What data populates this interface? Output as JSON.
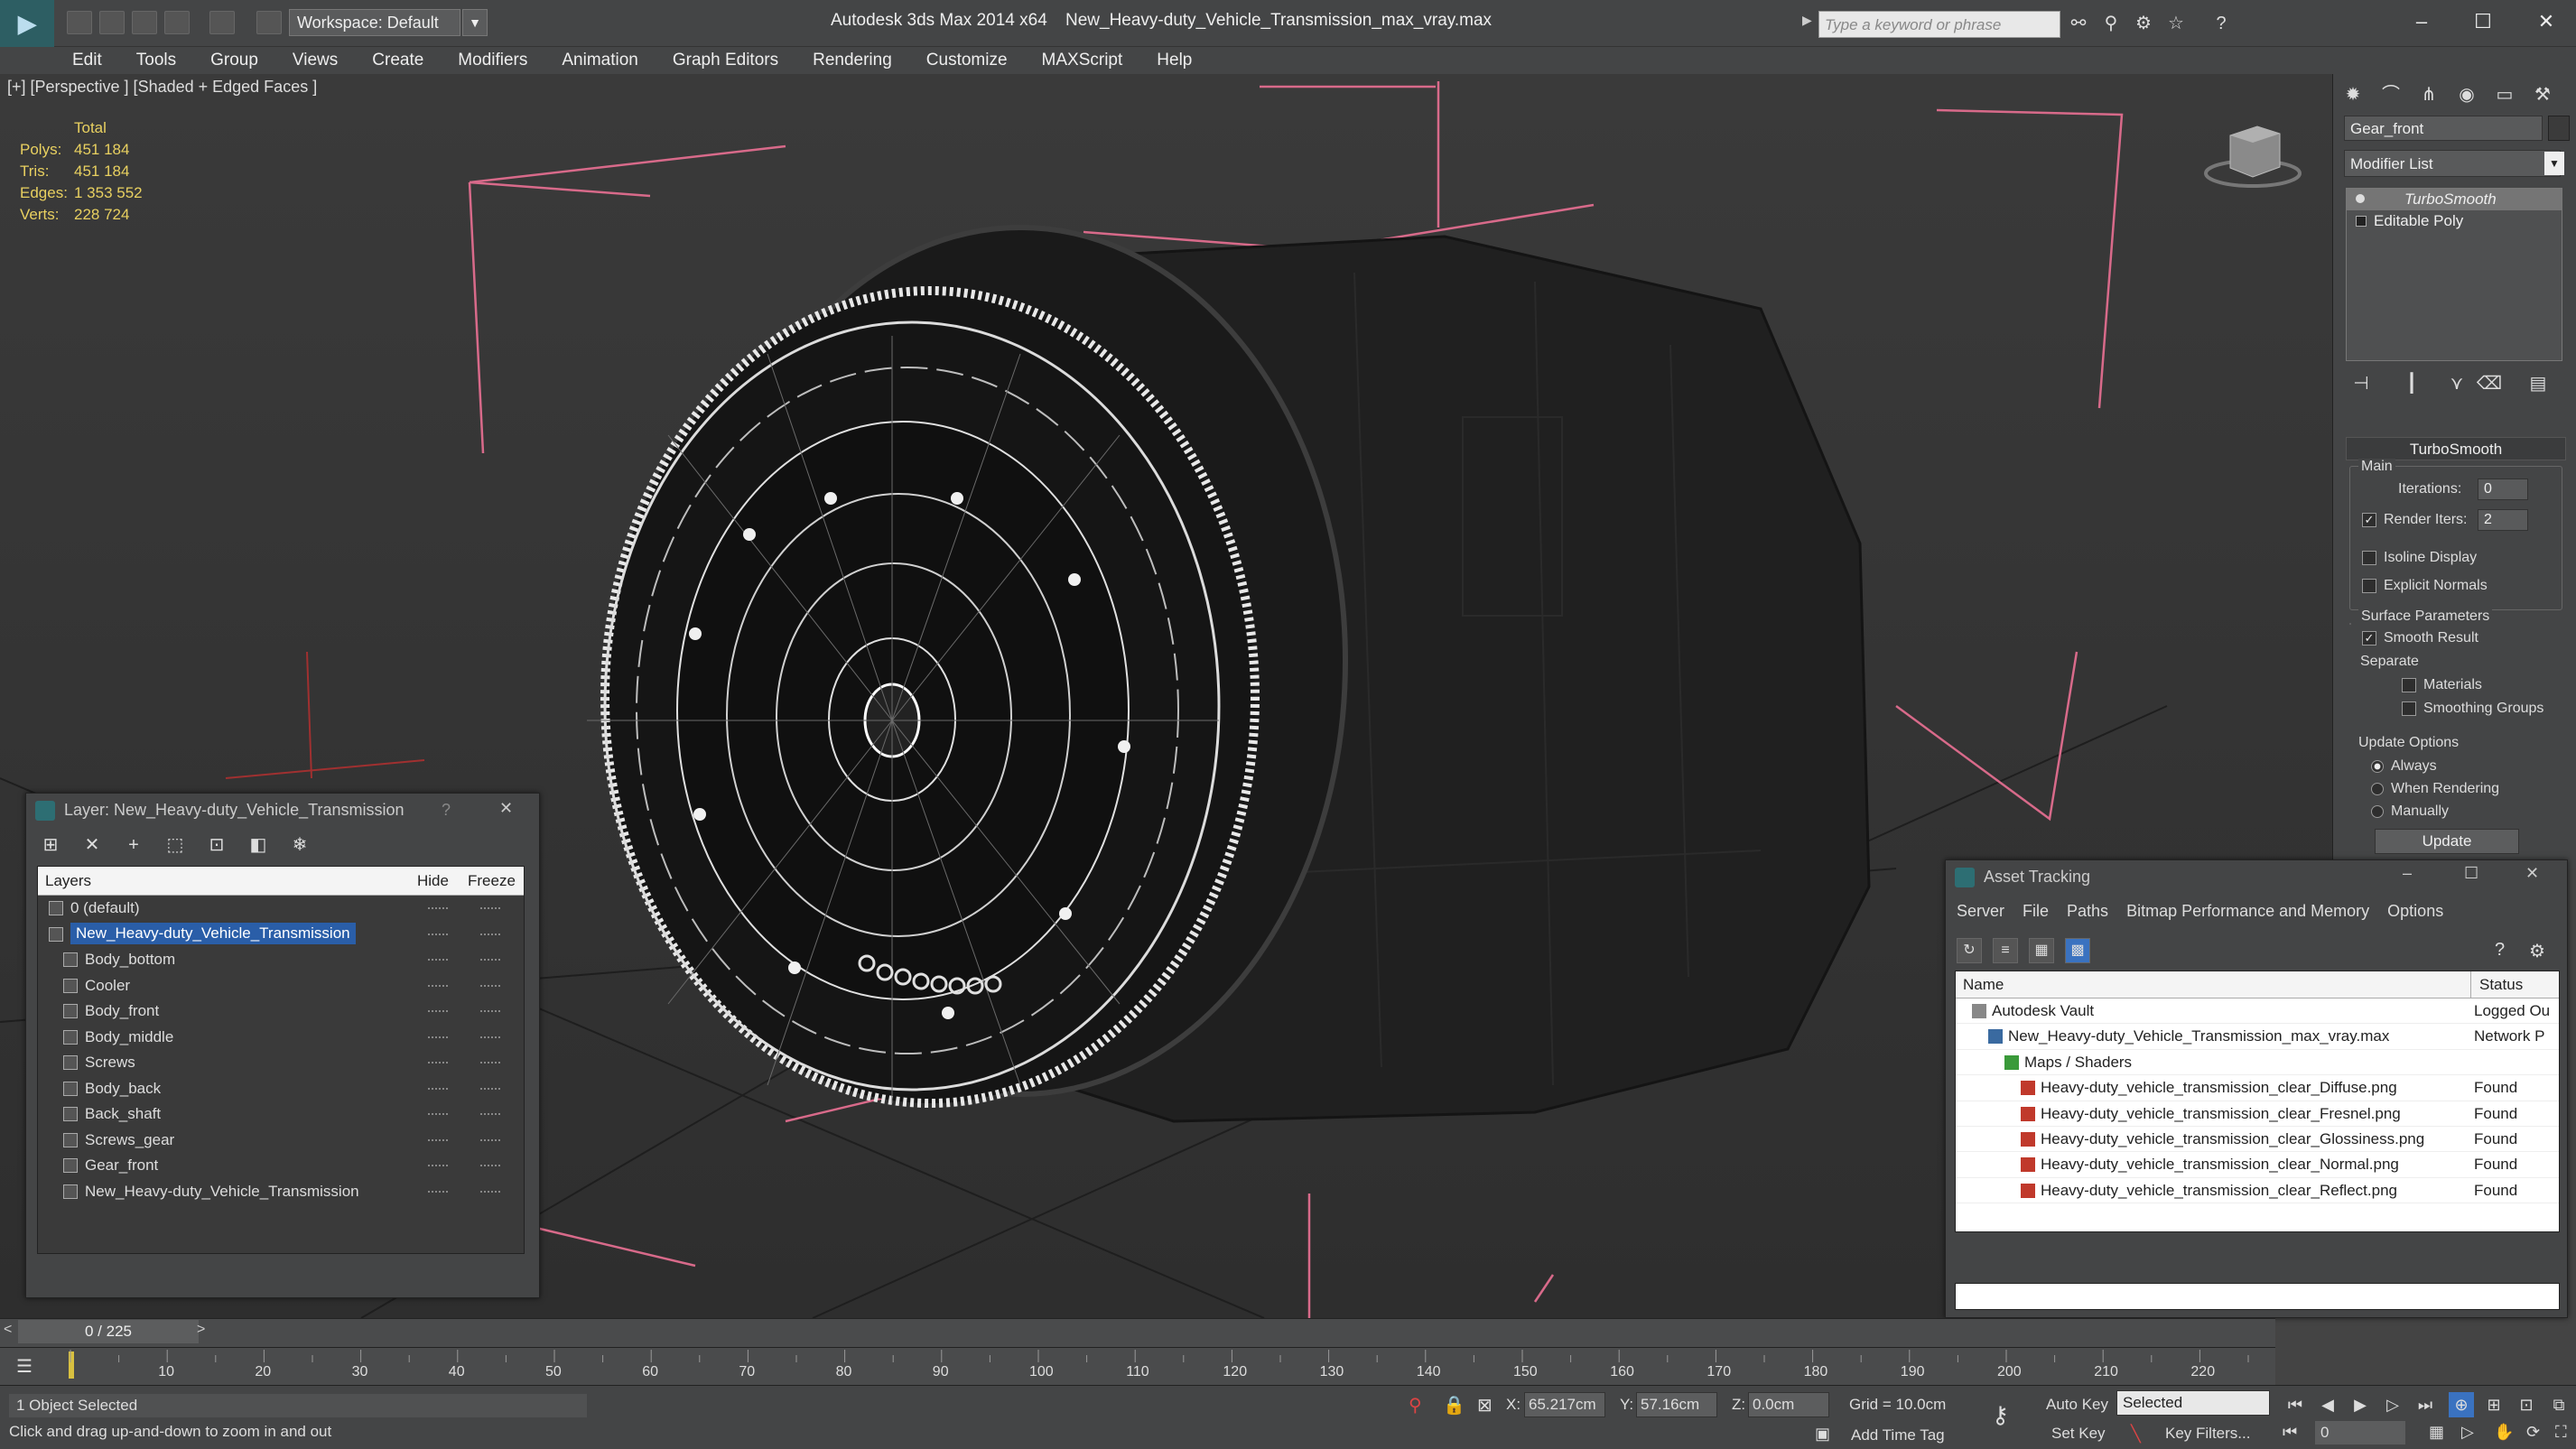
{
  "titlebar": {
    "workspace": "Workspace: Default",
    "app_title": "Autodesk 3ds Max  2014 x64",
    "doc_title": "New_Heavy-duty_Vehicle_Transmission_max_vray.max",
    "search_placeholder": "Type a keyword or phrase"
  },
  "menu": [
    "Edit",
    "Tools",
    "Group",
    "Views",
    "Create",
    "Modifiers",
    "Animation",
    "Graph Editors",
    "Rendering",
    "Customize",
    "MAXScript",
    "Help"
  ],
  "viewport": {
    "label": "[+] [Perspective ] [Shaded + Edged Faces ]",
    "stats_header": "Total",
    "stats": [
      {
        "k": "Polys:",
        "v": "451 184"
      },
      {
        "k": "Tris:",
        "v": "451 184"
      },
      {
        "k": "Edges:",
        "v": "1 353 552"
      },
      {
        "k": "Verts:",
        "v": "228 724"
      }
    ]
  },
  "command_panel": {
    "object_name": "Gear_front",
    "modifier_list": "Modifier List",
    "stack": [
      "TurboSmooth",
      "Editable Poly"
    ],
    "rollout_title": "TurboSmooth",
    "main_label": "Main",
    "iterations_label": "Iterations:",
    "iterations": "0",
    "render_iters_label": "Render Iters:",
    "render_iters": "2",
    "isoline": "Isoline Display",
    "explicit_normals": "Explicit Normals",
    "surface_params": "Surface Parameters",
    "smooth_result": "Smooth Result",
    "separate": "Separate",
    "materials": "Materials",
    "smoothing_groups": "Smoothing Groups",
    "update_options": "Update Options",
    "always": "Always",
    "when_rendering": "When Rendering",
    "manually": "Manually",
    "update_btn": "Update"
  },
  "layer_dialog": {
    "title": "Layer: New_Heavy-duty_Vehicle_Transmission",
    "help": "?",
    "close": "✕",
    "col_layers": "Layers",
    "col_hide": "Hide",
    "col_freeze": "Freeze",
    "rows": [
      {
        "name": "0 (default)",
        "indent": 0
      },
      {
        "name": "New_Heavy-duty_Vehicle_Transmission",
        "indent": 0,
        "selected": true
      },
      {
        "name": "Body_bottom",
        "indent": 1
      },
      {
        "name": "Cooler",
        "indent": 1
      },
      {
        "name": "Body_front",
        "indent": 1
      },
      {
        "name": "Body_middle",
        "indent": 1
      },
      {
        "name": "Screws",
        "indent": 1
      },
      {
        "name": "Body_back",
        "indent": 1
      },
      {
        "name": "Back_shaft",
        "indent": 1
      },
      {
        "name": "Screws_gear",
        "indent": 1
      },
      {
        "name": "Gear_front",
        "indent": 1
      },
      {
        "name": "New_Heavy-duty_Vehicle_Transmission",
        "indent": 1
      }
    ]
  },
  "asset_dialog": {
    "title": "Asset Tracking",
    "menu": [
      "Server",
      "File",
      "Paths",
      "Bitmap Performance and Memory",
      "Options"
    ],
    "col_name": "Name",
    "col_status": "Status",
    "rows": [
      {
        "name": "Autodesk Vault",
        "status": "Logged Ou",
        "level": 0
      },
      {
        "name": "New_Heavy-duty_Vehicle_Transmission_max_vray.max",
        "status": "Network P",
        "level": 1
      },
      {
        "name": "Maps / Shaders",
        "status": "",
        "level": 2
      },
      {
        "name": "Heavy-duty_vehicle_transmission_clear_Diffuse.png",
        "status": "Found",
        "level": 3
      },
      {
        "name": "Heavy-duty_vehicle_transmission_clear_Fresnel.png",
        "status": "Found",
        "level": 3
      },
      {
        "name": "Heavy-duty_vehicle_transmission_clear_Glossiness.png",
        "status": "Found",
        "level": 3
      },
      {
        "name": "Heavy-duty_vehicle_transmission_clear_Normal.png",
        "status": "Found",
        "level": 3
      },
      {
        "name": "Heavy-duty_vehicle_transmission_clear_Reflect.png",
        "status": "Found",
        "level": 3
      }
    ]
  },
  "timeline": {
    "frame": "0 / 225",
    "ticks": [
      "10",
      "20",
      "30",
      "40",
      "50",
      "60",
      "70",
      "80",
      "90",
      "100",
      "110",
      "120",
      "130",
      "140",
      "150",
      "160",
      "170",
      "180",
      "190",
      "200",
      "210",
      "220"
    ]
  },
  "status": {
    "selection": "1 Object Selected",
    "prompt": "Click and drag up-and-down to zoom in and out",
    "x_label": "X:",
    "x": "65.217cm",
    "y_label": "Y:",
    "y": "57.16cm",
    "z_label": "Z:",
    "z": "0.0cm",
    "grid": "Grid = 10.0cm",
    "add_time_tag": "Add Time Tag",
    "auto_key": "Auto Key",
    "set_key": "Set Key",
    "key_mode": "Selected",
    "key_filters": "Key Filters...",
    "current_frame": "0"
  },
  "colors": {
    "viewport_bg": "#333333",
    "stats_text": "#e8d060",
    "selection": "#2a5ea8",
    "bbox_pink": "#d86a8a"
  }
}
